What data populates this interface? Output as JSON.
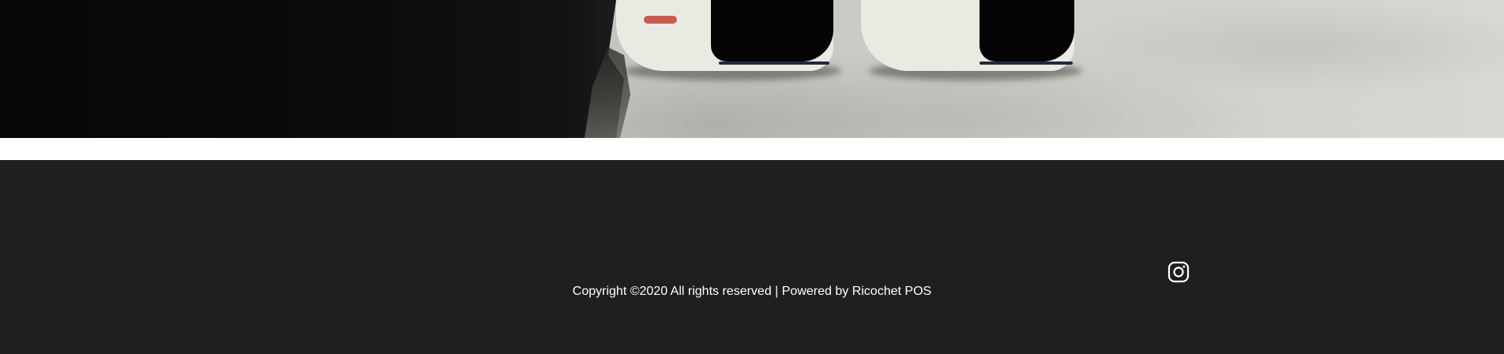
{
  "hero": {
    "image_description_icon": "photo-sneakers-on-concrete"
  },
  "footer": {
    "copyright_text": "Copyright ©2020 All rights reserved | Powered by Ricochet POS",
    "social": {
      "instagram_icon": "instagram-icon"
    }
  },
  "colors": {
    "footer_background": "#1f1f1f",
    "footer_text": "#ffffff",
    "page_background": "#ffffff"
  }
}
